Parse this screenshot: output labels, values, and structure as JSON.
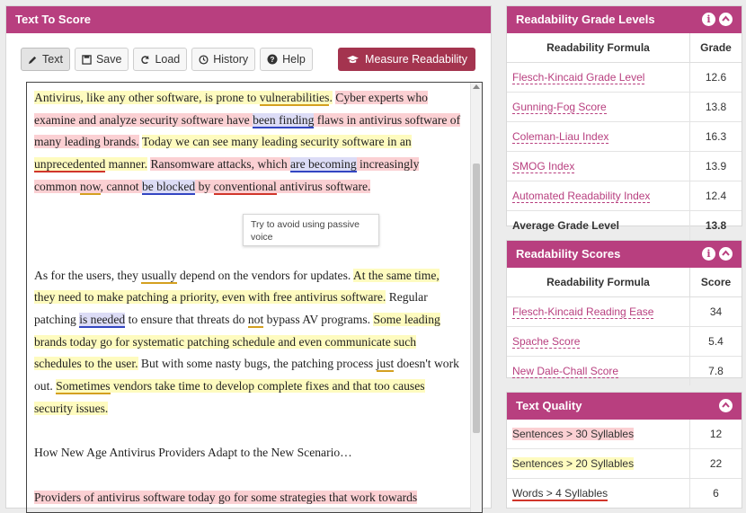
{
  "editor": {
    "title": "Text To Score",
    "buttons": {
      "text": "Text",
      "save": "Save",
      "load": "Load",
      "history": "History",
      "help": "Help"
    },
    "measure_label": "Measure Readability",
    "tooltip": "Try to avoid using passive voice",
    "p1": {
      "s1a": "Antivirus, like any other software, is prone to ",
      "s1b": "vulnerabilities",
      "s1c": ".",
      "s2a": "Cyber experts who examine and analyze security software have ",
      "s2b": "been finding",
      "s2c": " flaws in antivirus software of many leading brands.",
      "s3": "Today we can see many leading security software in an ",
      "s3b": "unprecedented",
      "s3c": " manner.",
      "s4a": "Ransomware attacks, which ",
      "s4b": "are becoming",
      "s4c": " increasingly common ",
      "s4d": "now",
      "s4e": ", cannot ",
      "s4f": "be blocked",
      "s4g": " by ",
      "s4h": "conventional",
      "s4i": " antivirus software."
    },
    "p2": {
      "s1a": "As for the users, they ",
      "s1b": "usually",
      "s1c": " depend on the vendors for updates. ",
      "s2": "At the same time, they need to make patching a priority, even with free antivirus software.",
      "s3a": " Regular patching ",
      "s3b": "is needed",
      "s3c": " to ensure that threats do ",
      "s3d": "not",
      "s3e": " bypass AV programs. ",
      "s4": "Some leading brands today go for systematic patching schedule and even communicate such schedules to the user.",
      "s5a": " But with some nasty bugs, the patching process ",
      "s5b": "just",
      "s5c": " doesn't work out. ",
      "s6a": "Sometimes",
      "s6b": " vendors take time to develop complete fixes and that too causes security issues."
    },
    "p3": "How New Age Antivirus Providers Adapt to the New Scenario…",
    "p4": "Providers of antivirus software today go for some strategies that work towards"
  },
  "grade_levels": {
    "title": "Readability Grade Levels",
    "col1": "Readability Formula",
    "col2": "Grade",
    "rows": [
      {
        "name": "Flesch-Kincaid Grade Level",
        "value": "12.6"
      },
      {
        "name": "Gunning-Fog Score",
        "value": "13.8"
      },
      {
        "name": "Coleman-Liau Index",
        "value": "16.3"
      },
      {
        "name": "SMOG Index",
        "value": "13.9"
      },
      {
        "name": "Automated Readability Index",
        "value": "12.4"
      }
    ],
    "avg_label": "Average Grade Level",
    "avg_value": "13.8"
  },
  "scores": {
    "title": "Readability Scores",
    "col1": "Readability Formula",
    "col2": "Score",
    "rows": [
      {
        "name": "Flesch-Kincaid Reading Ease",
        "value": "34"
      },
      {
        "name": "Spache Score",
        "value": "5.4"
      },
      {
        "name": "New Dale-Chall Score",
        "value": "7.8"
      }
    ]
  },
  "quality": {
    "title": "Text Quality",
    "rows": [
      {
        "name": "Sentences > 30 Syllables",
        "value": "12"
      },
      {
        "name": "Sentences > 20 Syllables",
        "value": "22"
      },
      {
        "name": "Words > 4 Syllables",
        "value": "6"
      }
    ]
  },
  "colors": {
    "header": "#b83f7f",
    "measure_button": "#a4344f",
    "highlight_red": "#fbd0d3",
    "highlight_yellow": "#fefbbf",
    "passive_blue": "#3346c2"
  }
}
